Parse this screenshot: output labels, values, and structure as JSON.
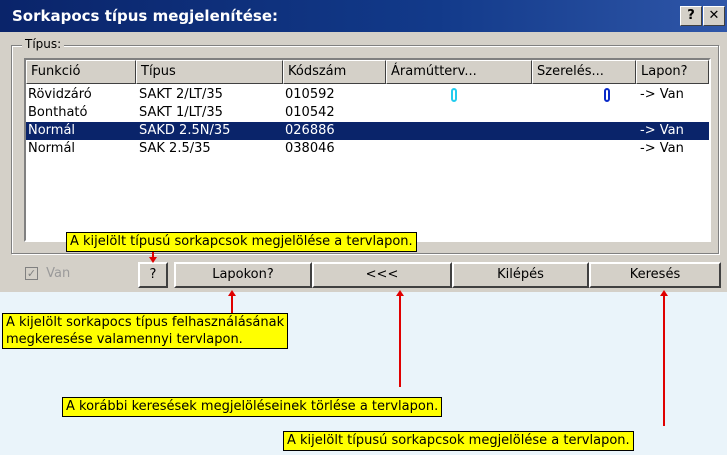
{
  "window": {
    "title": "Sorkapocs típus megjelenítése:",
    "help_label": "?",
    "close_label": "✕"
  },
  "group": {
    "label": "Típus:"
  },
  "table": {
    "columns": [
      "Funkció",
      "Típus",
      "Kódszám",
      "Áramútterv...",
      "Szerelés...",
      "Lapon?"
    ],
    "rows": [
      {
        "funkcio": "Rövidzáró",
        "tipus": "SAKT 2/LT/35",
        "kod": "010592",
        "lapon": "-> Van",
        "selected": false
      },
      {
        "funkcio": "Bontható",
        "tipus": "SAKT 1/LT/35",
        "kod": "010542",
        "lapon": "",
        "selected": false
      },
      {
        "funkcio": "Normál",
        "tipus": "SAKD 2.5N/35",
        "kod": "026886",
        "lapon": "-> Van",
        "selected": true
      },
      {
        "funkcio": "Normál",
        "tipus": "SAK 2.5/35",
        "kod": "038046",
        "lapon": "-> Van",
        "selected": false
      }
    ],
    "mark_colors": {
      "aramut": "#22ccee",
      "szereles": "#0a2ac8"
    }
  },
  "buttons": {
    "van_label": "Van",
    "question_label": "?",
    "lapokon_label": "Lapokon?",
    "back_label": "<<<",
    "exit_label": "Kilépés",
    "search_label": "Keresés"
  },
  "callouts": {
    "c1": "A kijelölt típusú sorkapcsok megjelölése a tervlapon.",
    "c2_line1": "A kijelölt sorkapocs típus felhasználásának",
    "c2_line2": "megkeresése valamennyi tervlapon.",
    "c3": "A korábbi keresések megjelöléseinek törlése a tervlapon.",
    "c4": "A kijelölt típusú sorkapcsok megjelölése a tervlapon."
  }
}
